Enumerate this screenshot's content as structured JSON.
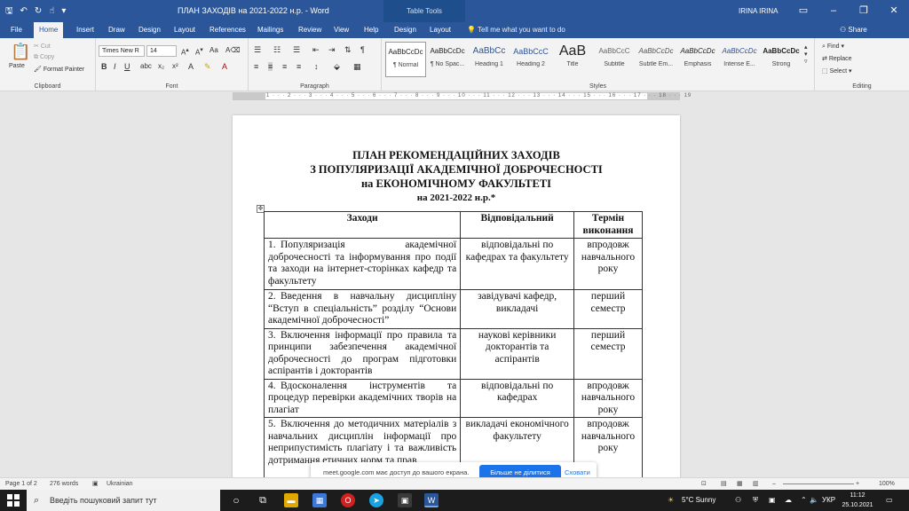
{
  "titlebar": {
    "doc_title": "ПЛАН ЗАХОДІВ на 2021-2022 н.р.  -  Word",
    "context_tab": "Table Tools",
    "user": "IRINA IRINA",
    "qat_icons": [
      "save-icon",
      "undo-icon",
      "redo-icon",
      "touch-mode-icon",
      "customize-icon"
    ]
  },
  "tabs": [
    "File",
    "Home",
    "Insert",
    "Draw",
    "Design",
    "Layout",
    "References",
    "Mailings",
    "Review",
    "View",
    "Help",
    "Design",
    "Layout"
  ],
  "tell_me": "Tell me what you want to do",
  "share": "Share",
  "ribbon": {
    "clipboard": {
      "label": "Clipboard",
      "paste": "Paste",
      "cut": "Cut",
      "copy": "Copy",
      "format_painter": "Format Painter"
    },
    "font": {
      "label": "Font",
      "name": "Times New R",
      "size": "14"
    },
    "paragraph": {
      "label": "Paragraph"
    },
    "styles": {
      "label": "Styles",
      "items": [
        {
          "preview": "AaBbCcDc",
          "name": "¶ Normal"
        },
        {
          "preview": "AaBbCcDc",
          "name": "¶ No Spac..."
        },
        {
          "preview": "AaBbCc",
          "name": "Heading 1"
        },
        {
          "preview": "AaBbCcC",
          "name": "Heading 2"
        },
        {
          "preview": "AaB",
          "name": "Title"
        },
        {
          "preview": "AaBbCcC",
          "name": "Subtitle"
        },
        {
          "preview": "AaBbCcDc",
          "name": "Subtle Em..."
        },
        {
          "preview": "AaBbCcDc",
          "name": "Emphasis"
        },
        {
          "preview": "AaBbCcDc",
          "name": "Intense E..."
        },
        {
          "preview": "AaBbCcDc",
          "name": "Strong"
        }
      ]
    },
    "editing": {
      "label": "Editing",
      "find": "Find",
      "replace": "Replace",
      "select": "Select"
    }
  },
  "ruler": {
    "ticks": "1 · · · 2 · · · 3 · · · 4 · · · 5 · · · 6 · · · 7 · · · 8 · · · 9 · · · 10 · · · 11 · · · 12 · · · 13 · · · 14 · · · 15 · · · 16 · · · 17 · · · 18 · · · 19"
  },
  "document": {
    "title_lines": [
      "ПЛАН РЕКОМЕНДАЦІЙНИХ ЗАХОДІВ",
      "З ПОПУЛЯРИЗАЦІЇ АКАДЕМІЧНОЇ ДОБРОЧЕСНОСТІ",
      "на ЕКОНОМІЧНОМУ ФАКУЛЬТЕТІ",
      "на 2021-2022 н.р.*"
    ],
    "table": {
      "headers": [
        "Заходи",
        "Відповідальний",
        "Термін виконання"
      ],
      "rows": [
        {
          "num": "1.",
          "measure": "Популяризація академічної доброчесності та інформування про події та заходи на інтернет-сторінках кафедр та факультету",
          "responsible": "відповідальні по кафедрах та факультету",
          "term": "впродовж навчального року"
        },
        {
          "num": "2.",
          "measure": "Введення в навчальну дисципліну “Вступ в спеціальність” розділу “Основи академічної доброчесності”",
          "responsible": "завідувачі кафедр, викладачі",
          "term": "перший семестр"
        },
        {
          "num": "3.",
          "measure": "Включення інформації про правила та принципи забезпечення академічної доброчесності до програм підготовки аспірантів і докторантів",
          "responsible": "наукові керівники докторантів та аспірантів",
          "term": "перший семестр"
        },
        {
          "num": "4.",
          "measure": "Вдосконалення інструментів та процедур перевірки академічних творів на плагіат",
          "responsible": "відповідальні по кафедрах",
          "term": "впродовж навчального року"
        },
        {
          "num": "5.",
          "measure": "Включення до методичних матеріалів з навчальних дисциплін інформації про неприпустимість плагіату і та важливість дотримання етичних норм та прав",
          "responsible": "викладачі економічного факультету",
          "term": "впродовж навчального року"
        }
      ]
    }
  },
  "notification": {
    "text": "meet.google.com має доступ до вашого екрана.",
    "stop_button": "Більше не ділитися",
    "hide_button": "Сховати"
  },
  "status": {
    "page": "Page 1 of 2",
    "words": "276 words",
    "language": "Ukrainian",
    "zoom": "100%"
  },
  "taskbar": {
    "search_placeholder": "Введіть пошуковий запит тут",
    "weather": "5°C  Sunny",
    "lang": "УКР",
    "time": "11:12",
    "date": "25.10.2021"
  }
}
